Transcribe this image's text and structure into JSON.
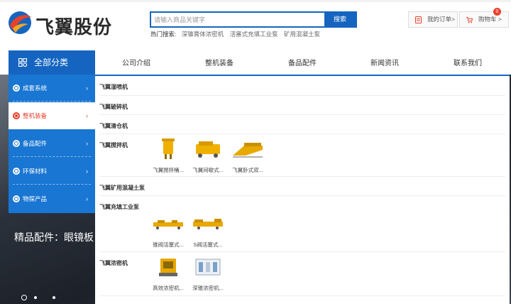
{
  "header": {
    "logo_text": "飞翼股份",
    "search": {
      "placeholder": "请输入商品关键字",
      "button_label": "搜索"
    },
    "hot_search": {
      "label": "热门搜索:",
      "links": [
        "深锥膏体浓密机",
        "活塞式充填工业泵",
        "矿用混凝土泵"
      ]
    },
    "orders_label": "我的订单>",
    "cart_label": "购物车 >",
    "cart_count": "0"
  },
  "nav": {
    "all_categories": "全部分类",
    "items": [
      "公司介绍",
      "整机装备",
      "备品配件",
      "新闻资讯",
      "联系我们"
    ]
  },
  "categories": [
    {
      "label": "成套系统",
      "active": false
    },
    {
      "label": "整机装备",
      "active": true
    },
    {
      "label": "备品配件",
      "active": false
    },
    {
      "label": "环保材料",
      "active": false
    },
    {
      "label": "物探产品",
      "active": false
    }
  ],
  "dropdown": {
    "rows": [
      {
        "title": "飞翼湿喷机",
        "products": []
      },
      {
        "title": "飞翼破碎机",
        "products": []
      },
      {
        "title": "飞翼清仓机",
        "products": []
      },
      {
        "title": "飞翼搅拌机",
        "products": [
          "飞翼搅拌桶...",
          "飞翼间歇式...",
          "飞翼卧式双..."
        ]
      },
      {
        "title": "飞翼矿用混凝土泵",
        "products": []
      },
      {
        "title": "飞翼充填工业泵",
        "products": [
          "锥阀活塞式...",
          "S阀活塞式..."
        ]
      },
      {
        "title": "飞翼浓密机",
        "products": [
          "高效浓密机...",
          "深锥浓密机..."
        ]
      }
    ]
  },
  "banner": {
    "text": "精品配件：眼镜板"
  },
  "colors": {
    "brand_blue": "#1565c0",
    "accent_red": "#e8402a"
  }
}
